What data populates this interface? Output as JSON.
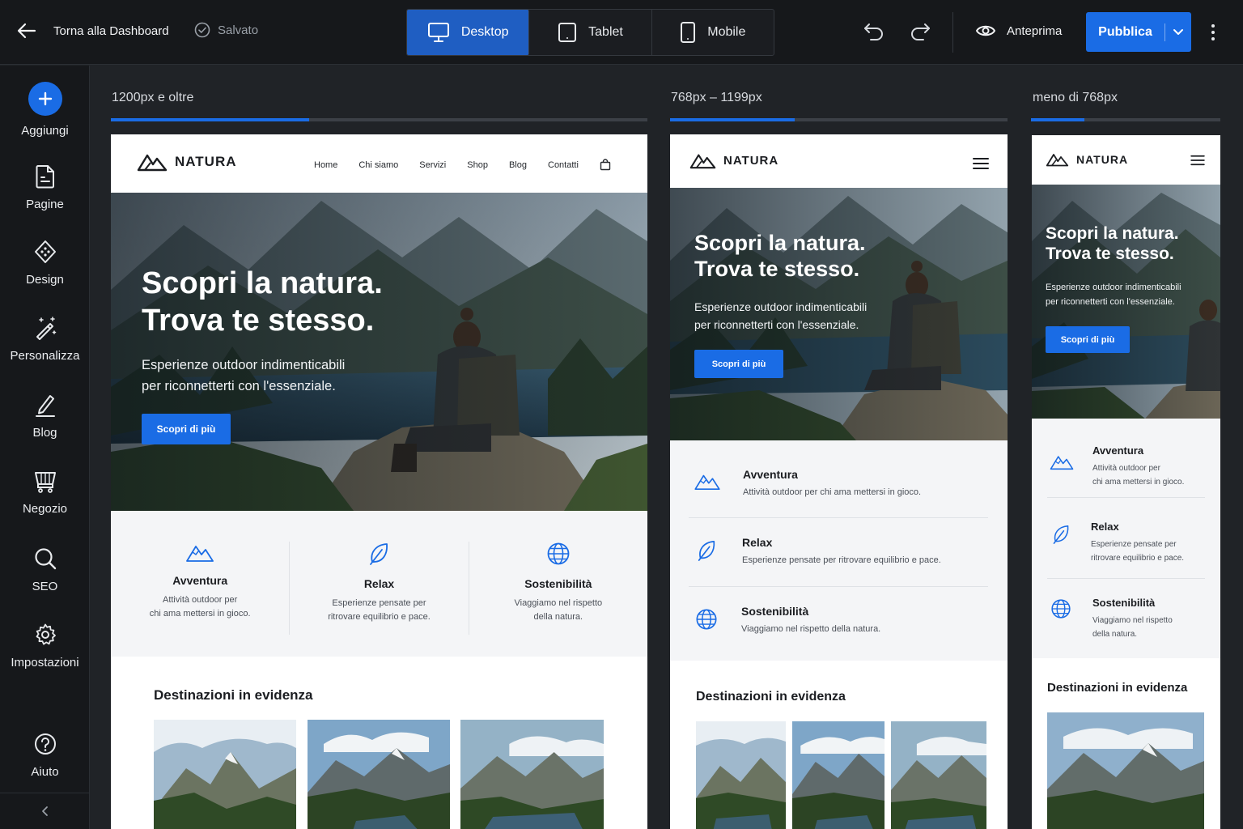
{
  "topbar": {
    "back_label": "Torna alla Dashboard",
    "saved_label": "Salvato",
    "devices": [
      {
        "label": "Desktop",
        "active": true
      },
      {
        "label": "Tablet",
        "active": false
      },
      {
        "label": "Mobile",
        "active": false
      }
    ],
    "preview_label": "Anteprima",
    "publish_label": "Pubblica"
  },
  "sidebar": {
    "items": [
      {
        "label": "Aggiungi",
        "icon": "plus-icon"
      },
      {
        "label": "Pagine",
        "icon": "page-icon"
      },
      {
        "label": "Design",
        "icon": "design-icon"
      },
      {
        "label": "Personalizza",
        "icon": "magic-wand-icon"
      },
      {
        "label": "Blog",
        "icon": "pencil-icon"
      },
      {
        "label": "Negozio",
        "icon": "cart-icon"
      },
      {
        "label": "SEO",
        "icon": "search-icon"
      },
      {
        "label": "Impostazioni",
        "icon": "gear-icon"
      },
      {
        "label": "Aiuto",
        "icon": "help-icon"
      }
    ]
  },
  "breakpoints": [
    {
      "label": "1200px e oltre",
      "fill": 0.37
    },
    {
      "label": "768px – 1199px",
      "fill": 0.37
    },
    {
      "label": "meno di 768px",
      "fill": 0.28
    }
  ],
  "site": {
    "logo": "NATURA",
    "nav": [
      "Home",
      "Chi siamo",
      "Servizi",
      "Shop",
      "Blog",
      "Contatti"
    ],
    "hero": {
      "title_line1": "Scopri la natura.",
      "title_line2": "Trova te stesso.",
      "subtitle_line1": "Esperienze outdoor indimenticabili",
      "subtitle_line2": "per riconnetterti con l'essenziale.",
      "cta": "Scopri di più"
    },
    "features": [
      {
        "title": "Avventura",
        "text": "Attività outdoor per chi ama mettersi in gioco.",
        "text_line1": "Attività outdoor per",
        "text_line2": "chi ama mettersi in gioco.",
        "icon": "mountain-icon"
      },
      {
        "title": "Relax",
        "text": "Esperienze pensate per ritrovare equilibrio e pace.",
        "text_line1": "Esperienze pensate per",
        "text_line2": "ritrovare equilibrio e pace.",
        "icon": "leaf-icon"
      },
      {
        "title": "Sostenibilità",
        "text": "Viaggiamo nel rispetto della natura.",
        "text_line1": "Viaggiamo nel rispetto",
        "text_line2": "della natura.",
        "icon": "globe-icon"
      }
    ],
    "destinations_title": "Destinazioni in evidenza"
  },
  "colors": {
    "accent": "#1a6ce5",
    "topbar_bg": "#16181b",
    "canvas_bg": "#202327"
  }
}
